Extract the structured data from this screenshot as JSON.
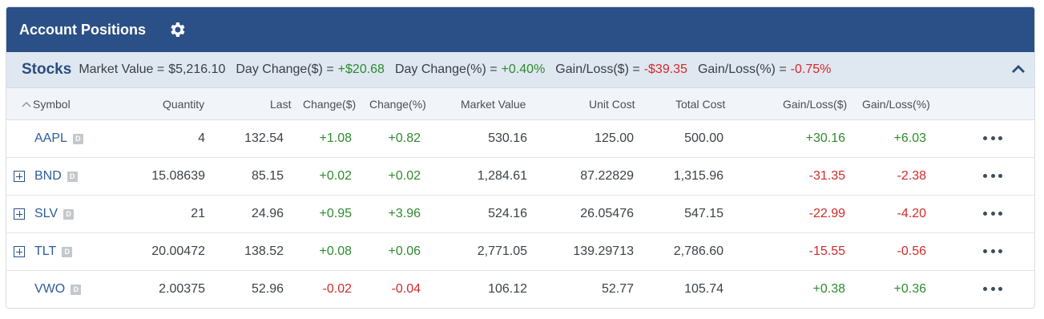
{
  "header": {
    "title": "Account Positions",
    "settings_icon": "gear-icon"
  },
  "summary": {
    "section": "Stocks",
    "market_value_label": "Market Value =",
    "market_value": "$5,216.10",
    "day_change_label": "Day Change($) =",
    "day_change": "+$20.68",
    "day_change_pct_label": "Day Change(%) =",
    "day_change_pct": "+0.40%",
    "gain_loss_label": "Gain/Loss($) =",
    "gain_loss": "-$39.35",
    "gain_loss_pct_label": "Gain/Loss(%) =",
    "gain_loss_pct": "-0.75%",
    "collapse_icon": "chevron-up-icon"
  },
  "columns": {
    "symbol": "Symbol",
    "quantity": "Quantity",
    "last": "Last",
    "change": "Change($)",
    "change_pct": "Change(%)",
    "market_value": "Market Value",
    "unit_cost": "Unit Cost",
    "total_cost": "Total Cost",
    "gain_loss": "Gain/Loss($)",
    "gain_loss_pct": "Gain/Loss(%)"
  },
  "badge_letter": "D",
  "rows": [
    {
      "symbol": "AAPL",
      "expandable": false,
      "quantity": "4",
      "last": "132.54",
      "change": "+1.08",
      "change_pct": "+0.82",
      "market_value": "530.16",
      "unit_cost": "125.00",
      "total_cost": "500.00",
      "gain_loss": "+30.16",
      "gain_loss_pct": "+6.03"
    },
    {
      "symbol": "BND",
      "expandable": true,
      "quantity": "15.08639",
      "last": "85.15",
      "change": "+0.02",
      "change_pct": "+0.02",
      "market_value": "1,284.61",
      "unit_cost": "87.22829",
      "total_cost": "1,315.96",
      "gain_loss": "-31.35",
      "gain_loss_pct": "-2.38"
    },
    {
      "symbol": "SLV",
      "expandable": true,
      "quantity": "21",
      "last": "24.96",
      "change": "+0.95",
      "change_pct": "+3.96",
      "market_value": "524.16",
      "unit_cost": "26.05476",
      "total_cost": "547.15",
      "gain_loss": "-22.99",
      "gain_loss_pct": "-4.20"
    },
    {
      "symbol": "TLT",
      "expandable": true,
      "quantity": "20.00472",
      "last": "138.52",
      "change": "+0.08",
      "change_pct": "+0.06",
      "market_value": "2,771.05",
      "unit_cost": "139.29713",
      "total_cost": "2,786.60",
      "gain_loss": "-15.55",
      "gain_loss_pct": "-0.56"
    },
    {
      "symbol": "VWO",
      "expandable": false,
      "quantity": "2.00375",
      "last": "52.96",
      "change": "-0.02",
      "change_pct": "-0.04",
      "market_value": "106.12",
      "unit_cost": "52.77",
      "total_cost": "105.74",
      "gain_loss": "+0.38",
      "gain_loss_pct": "+0.36"
    }
  ],
  "colors": {
    "header_bg": "#2b5087",
    "summary_bg": "#dfe7f1",
    "positive": "#2e8b2e",
    "negative": "#d42a2a",
    "link": "#2b5d9a"
  }
}
